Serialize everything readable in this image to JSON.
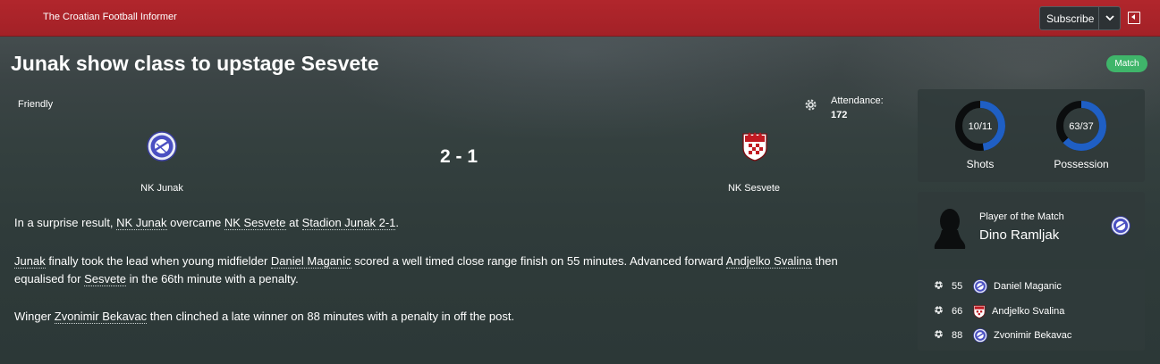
{
  "header": {
    "paper_name": "The Croatian Football Informer",
    "subscribe_label": "Subscribe",
    "icons": [
      "chevron-down-icon",
      "exit-icon"
    ],
    "brand_color": "#b1262c"
  },
  "article": {
    "headline": "Junak show class to upstage Sesvete",
    "badge": "Match",
    "badge_color": "#3fb56a"
  },
  "match": {
    "competition": "Friendly",
    "attendance_label": "Attendance:",
    "attendance_value": "172",
    "home": {
      "name": "NK Junak",
      "crest": "junak-crest-icon"
    },
    "away": {
      "name": "NK Sesvete",
      "crest": "sesvete-crest-icon"
    },
    "score": "2 - 1"
  },
  "report": {
    "p1": {
      "t1": "In a surprise result, ",
      "l1": "NK Junak",
      "t2": " overcame ",
      "l2": "NK Sesvete",
      "t3": " at ",
      "l3": "Stadion Junak 2-1",
      "t4": "."
    },
    "p2": {
      "l1": "Junak",
      "t1": " finally took the lead when young midfielder ",
      "l2": "Daniel Maganic",
      "t2": " scored a well timed close range finish on 55 minutes. Advanced forward ",
      "l3": "Andjelko Svalina",
      "t3": " then",
      "t4": "equalised for ",
      "l4": "Sesvete",
      "t5": " in the 66th minute with a penalty."
    },
    "p3": {
      "t1": "Winger ",
      "l1": "Zvonimir Bekavac",
      "t2": " then clinched a late winner on 88 minutes with a penalty in off the post."
    }
  },
  "stats": {
    "shots": {
      "label": "Shots",
      "value": "10/11",
      "home": 10,
      "away": 11
    },
    "possession": {
      "label": "Possession",
      "value": "63/37",
      "home": 63,
      "away": 37
    },
    "home_color": "#1f5fc4",
    "away_color": "#0b0d0e"
  },
  "player_of_match": {
    "label": "Player of the Match",
    "name": "Dino Ramljak"
  },
  "goals": [
    {
      "minute": "55",
      "team": "home",
      "player": "Daniel Maganic"
    },
    {
      "minute": "66",
      "team": "away",
      "player": "Andjelko Svalina"
    },
    {
      "minute": "88",
      "team": "home",
      "player": "Zvonimir Bekavac"
    }
  ]
}
